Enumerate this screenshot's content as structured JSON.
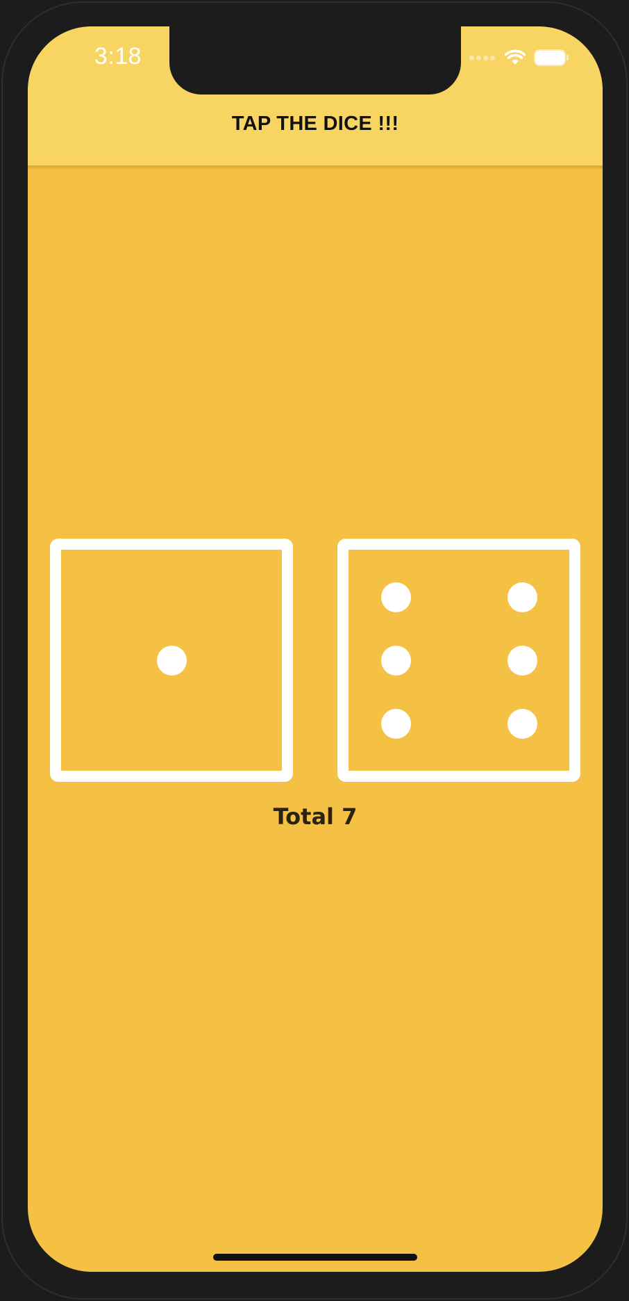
{
  "status_bar": {
    "time": "3:18"
  },
  "header": {
    "title": "TAP THE DICE !!!"
  },
  "dice": [
    {
      "value": 1
    },
    {
      "value": 6
    }
  ],
  "result": {
    "total_label": "Total 7"
  },
  "colors": {
    "background": "#f4c145",
    "header_background": "#f8d562",
    "die_color": "#ffffff",
    "text_color": "#111111",
    "total_color": "#2b2212"
  }
}
